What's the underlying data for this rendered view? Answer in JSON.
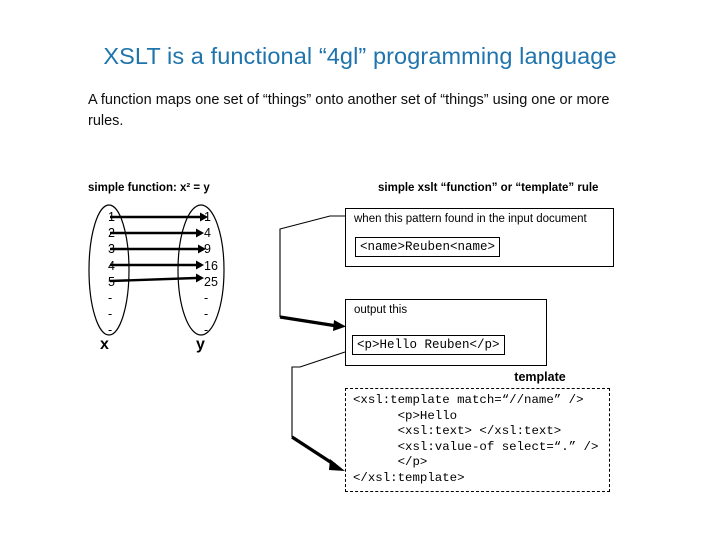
{
  "slide": {
    "title": "XSLT is a functional “4gl” programming language",
    "subtitle": "A function maps one set of “things” onto another set of “things” using one or more rules.",
    "title_color": "#1F74AD",
    "background_color": "#FFFFFF",
    "text_color": "#000000"
  },
  "left_diagram": {
    "caption": "simple function: x² = y",
    "domain_label": "x",
    "range_label": "y",
    "domain_values": [
      "1",
      "2",
      "3",
      "4",
      "5",
      "-",
      "-",
      "-"
    ],
    "range_values": [
      "1",
      "4",
      "9",
      "16",
      "25",
      "-",
      "-",
      "-"
    ],
    "arrow_count": 5
  },
  "right_diagram": {
    "caption": "simple xslt “function” or “template” rule",
    "pattern_box": {
      "label": "when this pattern found in the input document",
      "code": "<name>Reuben<name>"
    },
    "output_box": {
      "label": "output this",
      "code": "<p>Hello Reuben</p>"
    },
    "template_caption": "template",
    "template_code": "<xsl:template match=“//name” />\n      <p>Hello\n      <xsl:text> </xsl:text>\n      <xsl:value-of select=“.” />\n      </p>\n</xsl:template>"
  }
}
